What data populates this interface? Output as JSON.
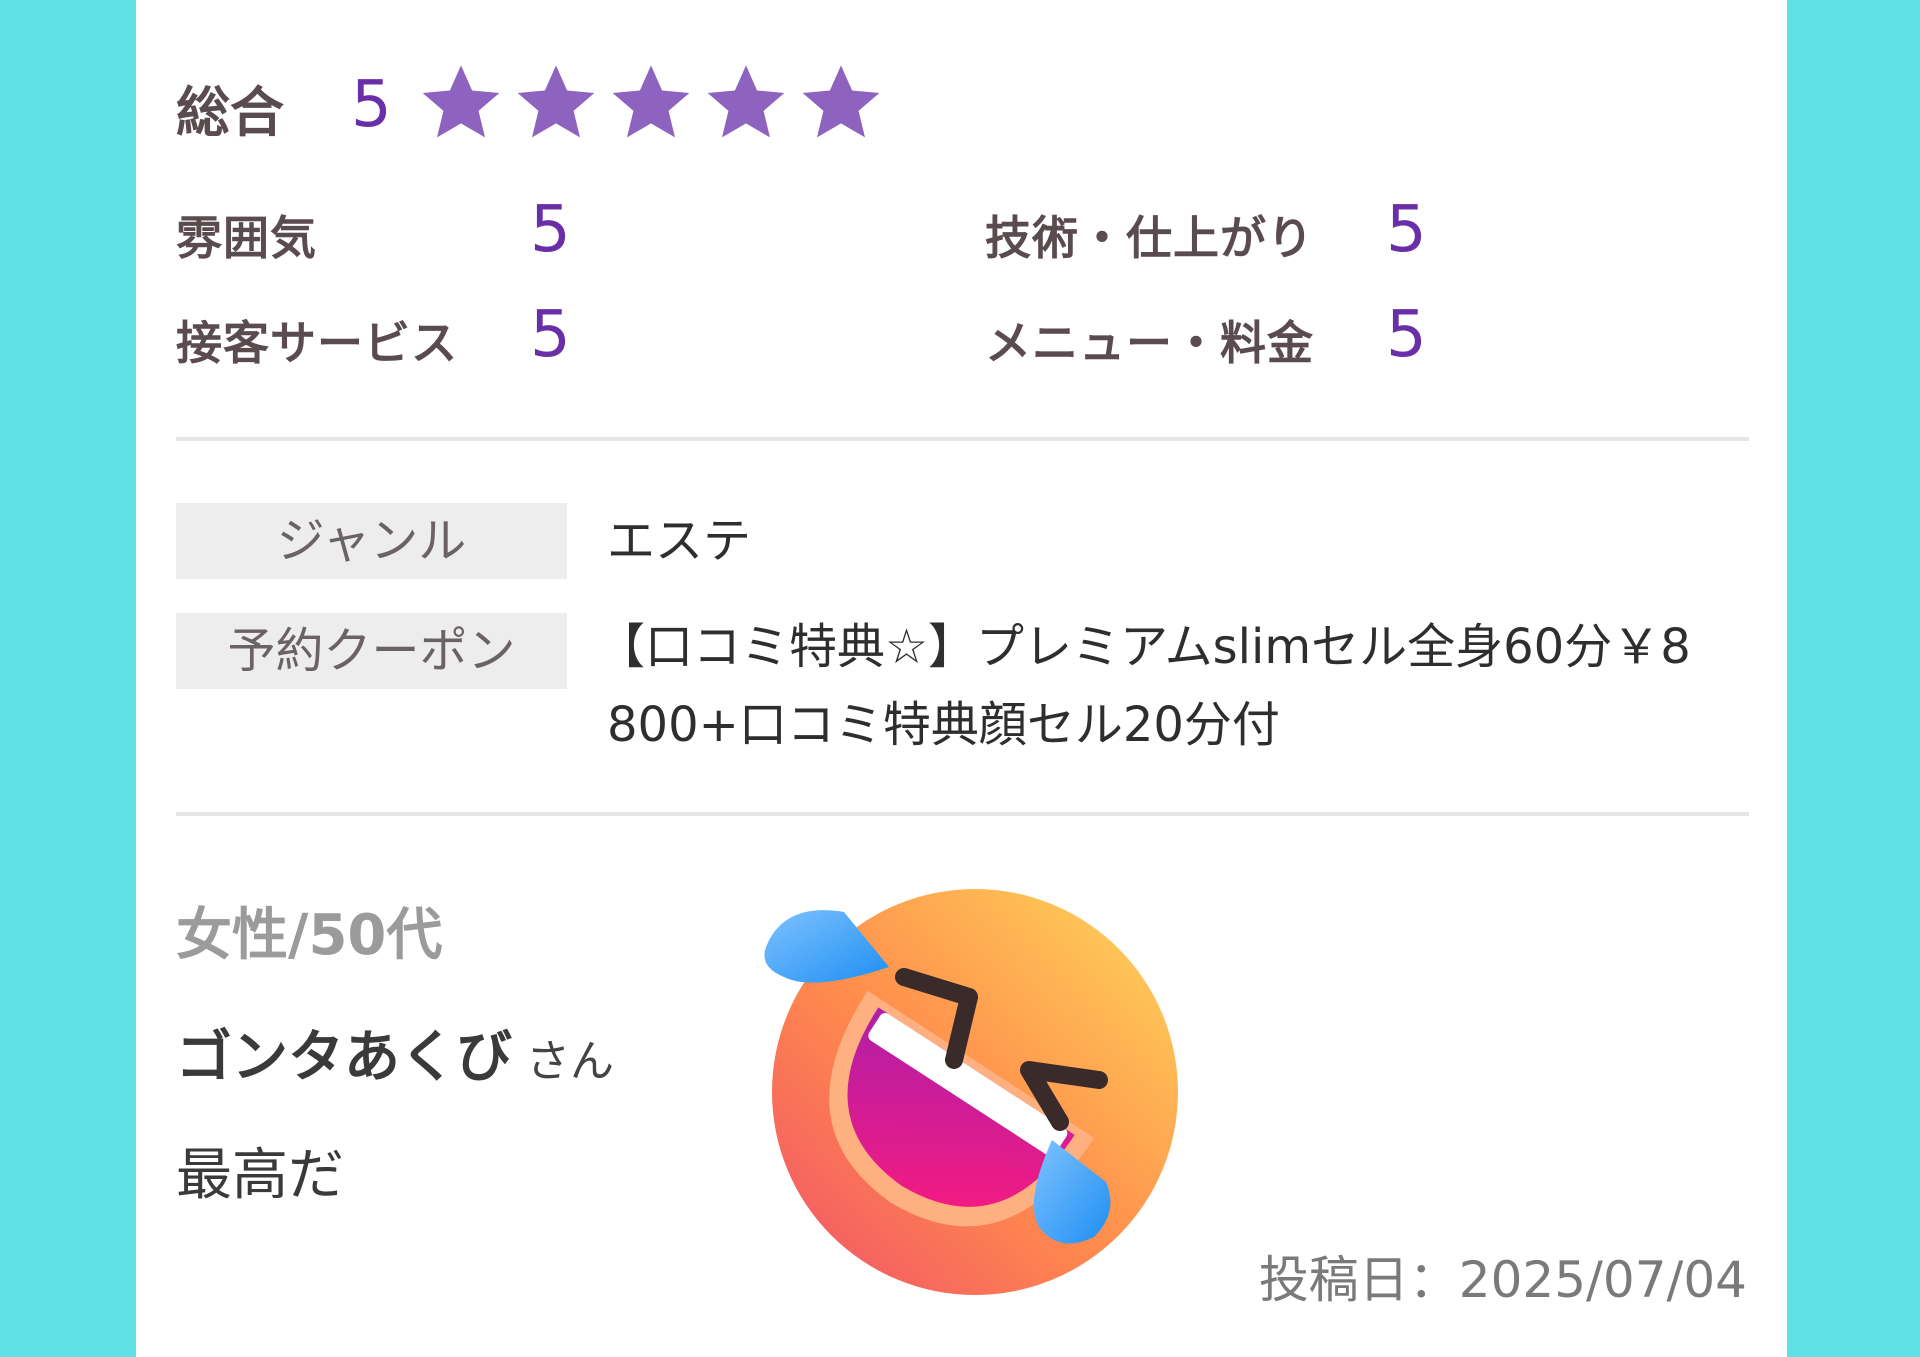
{
  "overall": {
    "label": "総合",
    "score": "5",
    "star_rating": 5,
    "star_max": 5,
    "star_color": "#8e62bf"
  },
  "ratings": [
    {
      "label": "雰囲気",
      "score": "5"
    },
    {
      "label": "技術・仕上がり",
      "score": "5"
    },
    {
      "label": "接客サービス",
      "score": "5"
    },
    {
      "label": "メニュー・料金",
      "score": "5"
    }
  ],
  "info": {
    "genre_label": "ジャンル",
    "genre_value": "エステ",
    "coupon_label": "予約クーポン",
    "coupon_line1": "【口コミ特典☆】プレミアムslimセル全身60分￥8",
    "coupon_line2": "800+口コミ特典顔セル20分付"
  },
  "reviewer": {
    "demographic": "女性/50代",
    "name": "ゴンタあくび",
    "honorific": "さん",
    "comment": "最高だ",
    "emoji": "rolling-on-floor-laughing-icon"
  },
  "posted": {
    "text": "投稿日：2025/07/04"
  },
  "colors": {
    "background": "#5fe0e4",
    "accent": "#6a2fa8"
  }
}
